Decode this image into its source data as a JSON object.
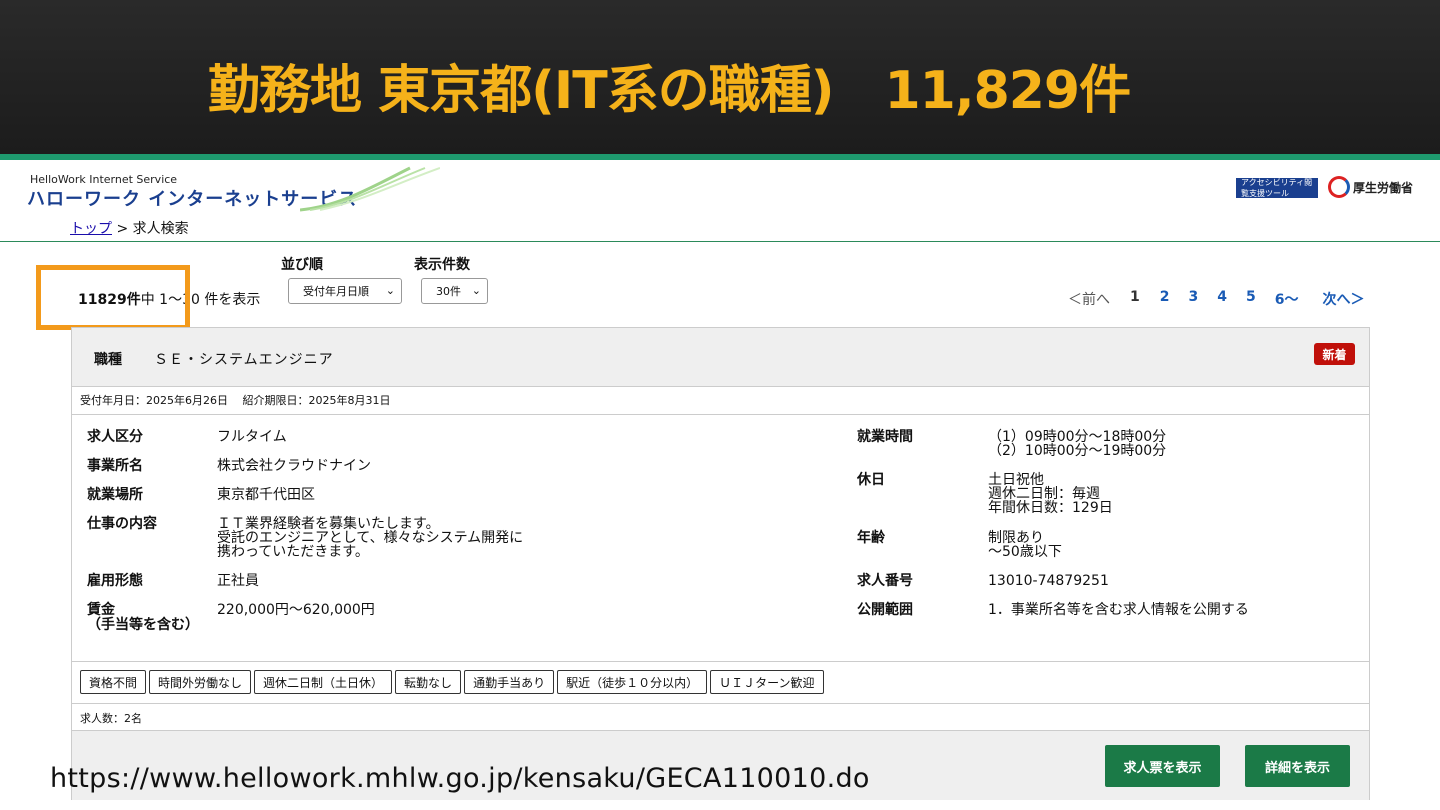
{
  "banner": {
    "title": "勤務地 東京都(IT系の職種)　11,829件"
  },
  "header": {
    "logo_en": "HelloWork Internet Service",
    "logo_jp": "ハローワーク インターネットサービス",
    "accessibility_tool_label": "アクセシビリティ閲覧支援ツール",
    "ministry_label": "厚生労働省"
  },
  "breadcrumb": {
    "home": "トップ",
    "separator": " > ",
    "current": "求人検索"
  },
  "controls": {
    "sort_label": "並び順",
    "count_label": "表示件数",
    "sort_value": "受付年月日順",
    "count_value": "30件"
  },
  "summary": {
    "total": "11829件",
    "rest": "中 1〜30 件を表示"
  },
  "pager": {
    "prev": "＜前へ",
    "current": "1",
    "pages": [
      "2",
      "3",
      "4",
      "5",
      "6〜"
    ],
    "next": "次へ＞"
  },
  "job": {
    "occupation_label": "職種",
    "occupation": "ＳＥ・システムエンジニア",
    "badge": "新着",
    "dates": "受付年月日：2025年6月26日　 紹介期限日：2025年8月31日",
    "left": [
      {
        "key": "求人区分",
        "lines": [
          "フルタイム"
        ]
      },
      {
        "key": "事業所名",
        "lines": [
          "株式会社クラウドナイン"
        ]
      },
      {
        "key": "就業場所",
        "lines": [
          "東京都千代田区"
        ]
      },
      {
        "key": "仕事の内容",
        "lines": [
          "ＩＴ業界経験者を募集いたします。",
          "受託のエンジニアとして、様々なシステム開発に",
          "携わっていただきます。"
        ]
      },
      {
        "key": "雇用形態",
        "lines": [
          "正社員"
        ]
      },
      {
        "key": "賃金",
        "key2": "（手当等を含む）",
        "lines": [
          "220,000円〜620,000円"
        ]
      }
    ],
    "right": [
      {
        "key": "就業時間",
        "lines": [
          "（1）09時00分〜18時00分",
          "（2）10時00分〜19時00分"
        ]
      },
      {
        "key": "休日",
        "lines": [
          "土日祝他",
          "週休二日制：毎週",
          "年間休日数：129日"
        ]
      },
      {
        "key": "年齢",
        "lines": [
          "制限あり",
          "〜50歳以下"
        ]
      },
      {
        "key": "求人番号",
        "lines": [
          "13010-74879251"
        ]
      },
      {
        "key": "公開範囲",
        "lines": [
          "1．事業所名等を含む求人情報を公開する"
        ]
      }
    ],
    "tags": [
      "資格不問",
      "時間外労働なし",
      "週休二日制（土日休）",
      "転勤なし",
      "通勤手当あり",
      "駅近（徒歩１０分以内）",
      "ＵＩＪターン歓迎"
    ],
    "openings": "求人数：2名",
    "buttons": {
      "ticket": "求人票を表示",
      "detail": "詳細を表示"
    }
  },
  "footer_url": "https://www.hellowork.mhlw.go.jp/kensaku/GECA110010.do",
  "colors": {
    "banner_title": "#f5b21a",
    "accent_green": "#1b7a47",
    "highlight": "#f39a1b",
    "badge_red": "#c0100a"
  }
}
